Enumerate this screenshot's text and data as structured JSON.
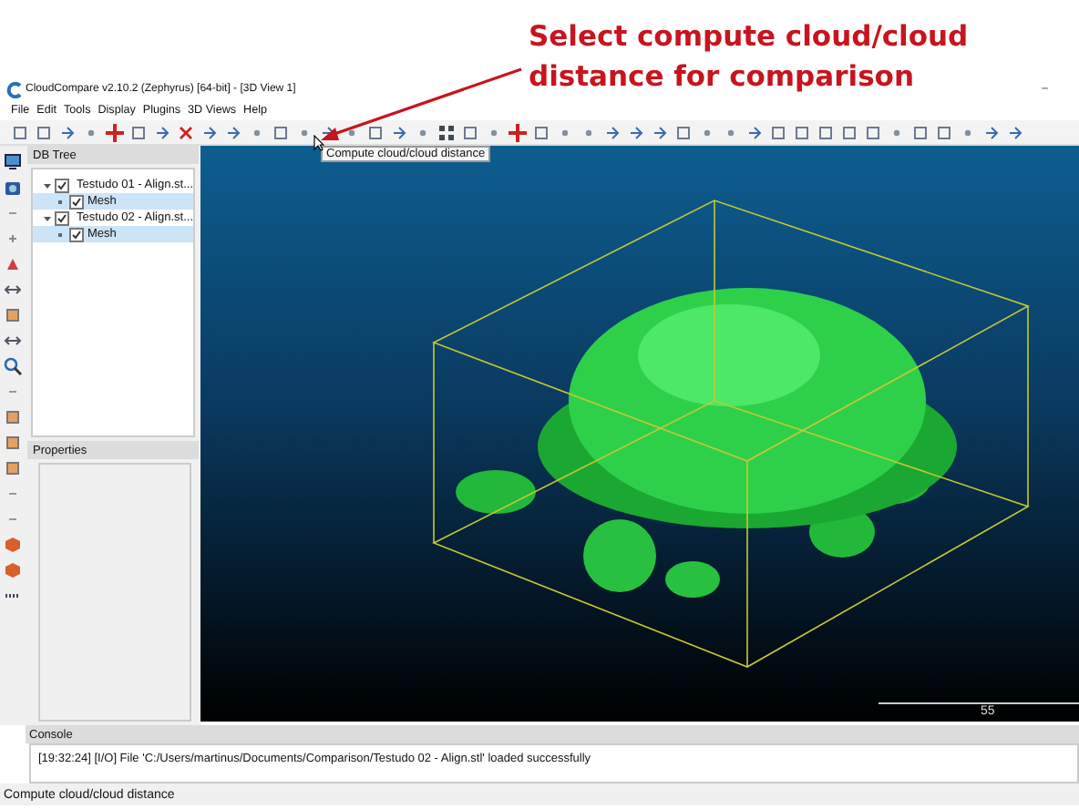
{
  "annotation": {
    "lines": [
      "Select compute cloud/cloud",
      "distance for comparison"
    ]
  },
  "window": {
    "title": "CloudCompare v2.10.2 (Zephyrus) [64-bit] - [3D View 1]",
    "minimize": "–"
  },
  "menu": [
    "File",
    "Edit",
    "Tools",
    "Display",
    "Plugins",
    "3D Views",
    "Help"
  ],
  "tooltip": "Compute cloud/cloud distance",
  "db_tree": {
    "title": "DB Tree",
    "items": [
      {
        "label": "Testudo 01 - Align.st...",
        "checked": true,
        "expanded": true,
        "selected": false,
        "children": [
          {
            "label": "Mesh",
            "checked": true,
            "selected": true
          }
        ]
      },
      {
        "label": "Testudo 02 - Align.st...",
        "checked": true,
        "expanded": true,
        "selected": false,
        "children": [
          {
            "label": "Mesh",
            "checked": true,
            "selected": true
          }
        ]
      }
    ]
  },
  "properties": {
    "title": "Properties"
  },
  "view": {
    "scale_label": "55"
  },
  "console": {
    "title": "Console",
    "lines": [
      "[19:32:24] [I/O] File 'C:/Users/martinus/Documents/Comparison/Testudo 02 - Align.stl' loaded successfully"
    ]
  },
  "status_bar": "Compute cloud/cloud distance"
}
